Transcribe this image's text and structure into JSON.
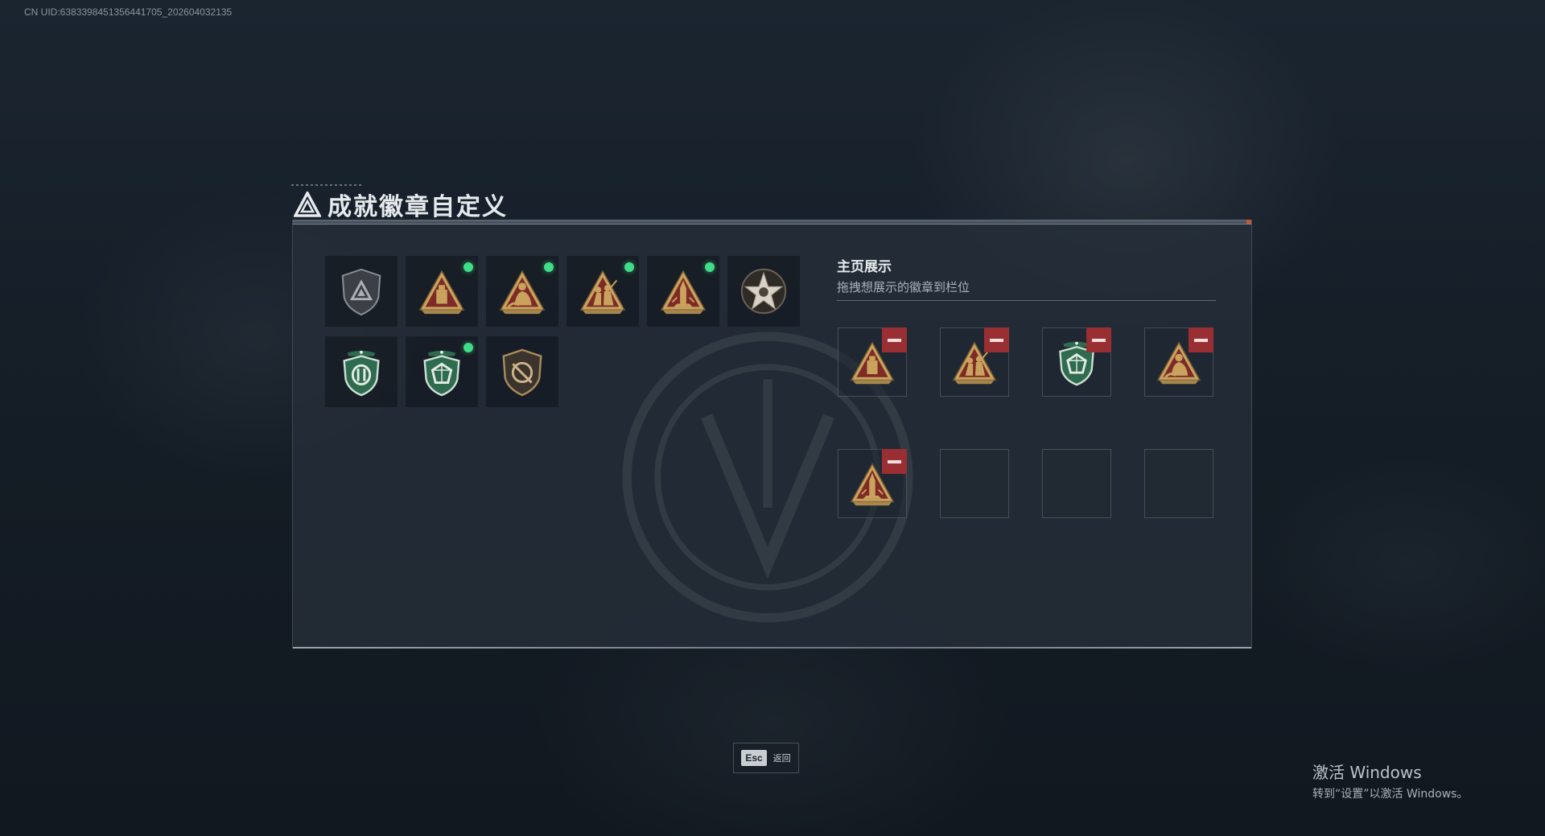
{
  "uid_text": "CN UID:6383398451356441705_202604032135",
  "page_title": "成就徽章自定义",
  "colors": {
    "panel_bg": "#262f3a",
    "new_indicator": "#3fdc8c",
    "remove_button": "#9a2f33",
    "badge_gold": "#c9a35e",
    "badge_red": "#7e2a26",
    "badge_green": "#2f6b4f"
  },
  "badge_collection": [
    {
      "name": "gray-shield-badge",
      "icon": "shield-triangle",
      "is_new": false
    },
    {
      "name": "crate-triangle-badge",
      "icon": "triangle-crate",
      "is_new": true
    },
    {
      "name": "seated-soldier-triangle-badge",
      "icon": "triangle-seated-figure",
      "is_new": true
    },
    {
      "name": "soldiers-triangle-badge",
      "icon": "triangle-soldiers",
      "is_new": true
    },
    {
      "name": "rocket-triangle-badge",
      "icon": "triangle-rocket",
      "is_new": true
    },
    {
      "name": "star-medal-badge",
      "icon": "round-star",
      "is_new": false
    },
    {
      "name": "green-shield-arrows-badge",
      "icon": "green-shield-arrows",
      "is_new": false
    },
    {
      "name": "green-shield-gem-badge",
      "icon": "green-shield-gem",
      "is_new": true
    },
    {
      "name": "bronze-shield-badge",
      "icon": "bronze-shield-crossed",
      "is_new": false
    }
  ],
  "showcase": {
    "title": "主页展示",
    "subtitle": "拖拽想展示的徽章到栏位",
    "slots": [
      {
        "badge": "triangle-crate"
      },
      {
        "badge": "triangle-soldiers"
      },
      {
        "badge": "green-shield-gem"
      },
      {
        "badge": "triangle-seated-figure"
      },
      {
        "badge": "triangle-rocket"
      },
      {
        "badge": null
      },
      {
        "badge": null
      },
      {
        "badge": null
      }
    ]
  },
  "footer": {
    "esc_key": "Esc",
    "esc_label": "返回"
  },
  "watermark": {
    "title": "激活 Windows",
    "subtitle": "转到“设置”以激活 Windows。"
  }
}
